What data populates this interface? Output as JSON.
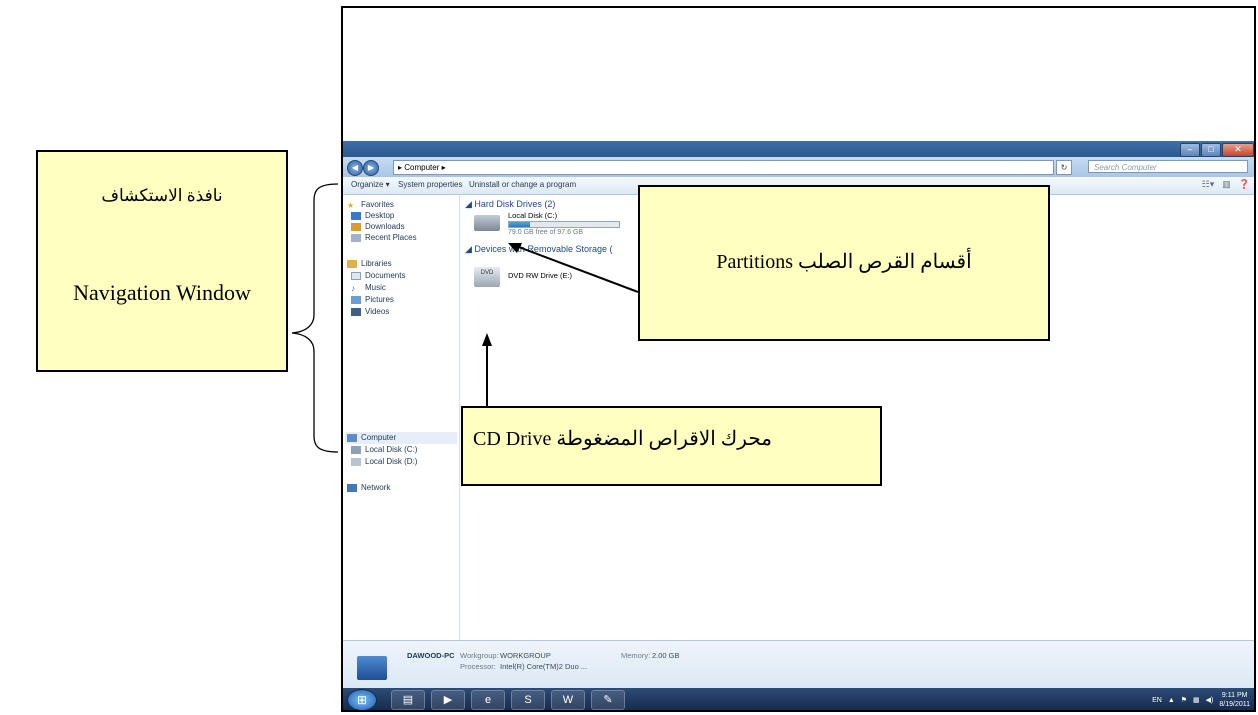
{
  "annotations": {
    "navigation": {
      "arabic": "نافذة الاستكشاف",
      "english": "Navigation Window"
    },
    "partitions": "أقسام القرص الصلب Partitions",
    "cd_drive": "محرك الاقراص المضغوطة CD Drive"
  },
  "explorer": {
    "address": "Computer",
    "search_placeholder": "Search Computer",
    "commands": [
      "Organize ▾",
      "System properties",
      "Uninstall or change a program"
    ],
    "nav": {
      "favorites": "Favorites",
      "desktop": "Desktop",
      "downloads": "Downloads",
      "recent": "Recent Places",
      "libraries": "Libraries",
      "documents": "Documents",
      "music": "Music",
      "pictures": "Pictures",
      "videos": "Videos",
      "computer": "Computer",
      "local_c": "Local Disk (C:)",
      "local_d": "Local Disk (D:)",
      "network": "Network"
    },
    "groups": {
      "hdd": "Hard Disk Drives (2)",
      "removable": "Devices with Removable Storage ("
    },
    "drives": {
      "c_name": "Local Disk (C:)",
      "c_free": "79.0 GB free of 97.6 GB",
      "c_used_fraction": 0.19,
      "dvd_name": "DVD RW Drive (E:)",
      "dvd_label": "DVD"
    },
    "details": {
      "pc_name": "DAWOOD-PC",
      "workgroup_label": "Workgroup:",
      "workgroup": "WORKGROUP",
      "memory_label": "Memory:",
      "memory": "2.00 GB",
      "processor_label": "Processor:",
      "processor": "Intel(R) Core(TM)2 Duo ..."
    },
    "tray": {
      "lang": "EN",
      "time": "9:11 PM",
      "date": "8/19/2011"
    }
  }
}
